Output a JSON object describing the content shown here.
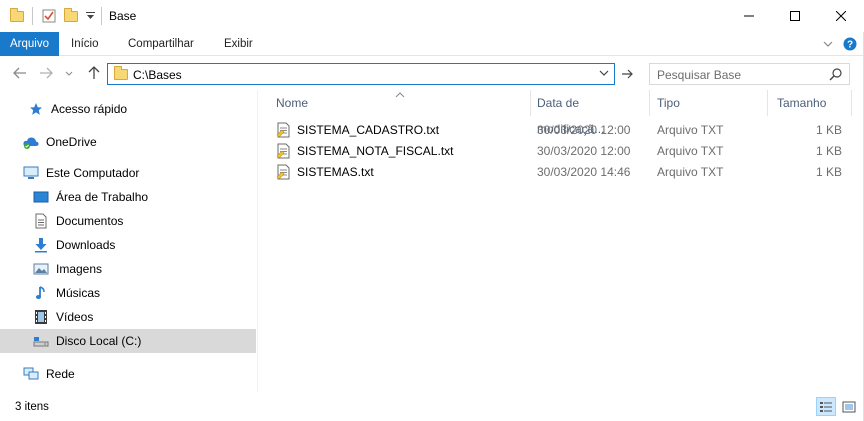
{
  "window": {
    "title": "Base",
    "controls": {
      "minimize": "minimize-icon",
      "maximize": "maximize-icon",
      "close": "close-icon"
    }
  },
  "ribbon": {
    "tabs": [
      {
        "label": "Arquivo",
        "active": true
      },
      {
        "label": "Início"
      },
      {
        "label": "Compartilhar"
      },
      {
        "label": "Exibir"
      }
    ]
  },
  "address": {
    "path": "C:\\Bases",
    "search_placeholder": "Pesquisar Base"
  },
  "navigation": {
    "items": [
      {
        "label": "Acesso rápido",
        "icon": "star-icon"
      },
      {
        "label": "OneDrive",
        "icon": "cloud-icon"
      },
      {
        "label": "Este Computador",
        "icon": "computer-icon"
      },
      {
        "label": "Área de Trabalho",
        "icon": "desktop-icon"
      },
      {
        "label": "Documentos",
        "icon": "documents-icon"
      },
      {
        "label": "Downloads",
        "icon": "download-icon"
      },
      {
        "label": "Imagens",
        "icon": "pictures-icon"
      },
      {
        "label": "Músicas",
        "icon": "music-icon"
      },
      {
        "label": "Vídeos",
        "icon": "videos-icon"
      },
      {
        "label": "Disco Local (C:)",
        "icon": "drive-icon",
        "selected": true
      },
      {
        "label": "Rede",
        "icon": "network-icon"
      }
    ]
  },
  "columns": {
    "name": "Nome",
    "date": "Data de modificaçã...",
    "type": "Tipo",
    "size": "Tamanho"
  },
  "files": [
    {
      "name": "SISTEMA_CADASTRO.txt",
      "date": "30/03/2020 12:00",
      "type": "Arquivo TXT",
      "size": "1 KB"
    },
    {
      "name": "SISTEMA_NOTA_FISCAL.txt",
      "date": "30/03/2020 12:00",
      "type": "Arquivo TXT",
      "size": "1 KB"
    },
    {
      "name": "SISTEMAS.txt",
      "date": "30/03/2020 14:46",
      "type": "Arquivo TXT",
      "size": "1 KB"
    }
  ],
  "status": {
    "item_count": "3 itens"
  },
  "colors": {
    "accent": "#1979ca",
    "selected_nav": "#d9d9d9",
    "header_text": "#4c607a"
  }
}
